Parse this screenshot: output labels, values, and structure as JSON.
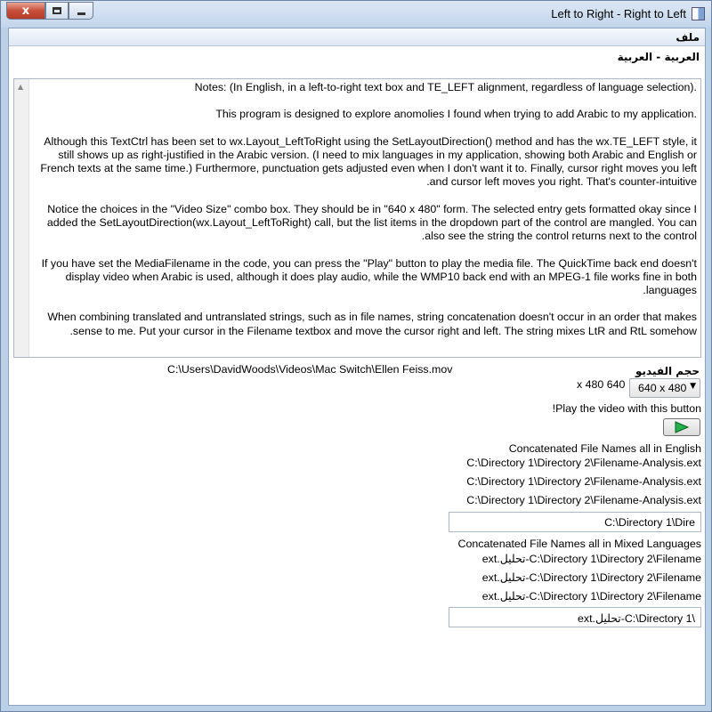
{
  "window": {
    "title": "Left to Right - Right to Left",
    "close_glyph": "x"
  },
  "menu": {
    "file": "ملف"
  },
  "language_title": "العربية - العربية",
  "notes": [
    ".Notes:  (In English, in a left-to-right text box and TE_LEFT alignment, regardless of language selection)",
    ".This program is designed to explore anomolies I found when trying to add Arabic to my application",
    "Although this TextCtrl has been set to wx.Layout_LeftToRight using the SetLayoutDirection() method and has the wx.TE_LEFT style, it still shows up as right-justified in the Arabic version.  (I need to mix languages in my application, showing both Arabic and English or French texts at the same time.)  Furthermore, punctuation gets adjusted even when I don't want it to.  Finally, cursor right moves you left and cursor left moves you right.  That's counter-intuitive.",
    "Notice the choices in the \"Video Size\" combo box.  They should be in \"640 x 480\" form.  The selected entry gets formatted okay since I added the SetLayoutDirection(wx.Layout_LeftToRight) call, but the list items in the dropdown part of the control are mangled.  You can also see the string the control returns next to the control.",
    "If you have set the MediaFilename in the code, you can press the \"Play\" button to play the media file.  The QuickTime back end doesn't display video when Arabic is used, although it does play audio, while the WMP10 back end with an MPEG-1 file works fine in both languages.",
    "When combining translated and untranslated strings, such as in file names, string concatenation doesn't occur in an order that makes sense to me.  Put your cursor in the Filename textbox and move the cursor right and left.  The string mixes LtR and RtL somehow."
  ],
  "video": {
    "size_label": "حجم الفيديو",
    "media_path": "C:\\Users\\DavidWoods\\Videos\\Mac Switch\\Ellen Feiss.mov",
    "size_selected": "640 x 480",
    "size_echo": "x 480 640"
  },
  "play": {
    "label": "!Play the video with this button",
    "icon": "play-icon",
    "icon_color": "#22b14c"
  },
  "english": {
    "title": "Concatenated File Names all in English",
    "lines": [
      "C:\\Directory 1\\Directory 2\\Filename-Analysis.ext",
      "C:\\Directory 1\\Directory 2\\Filename-Analysis.ext",
      "C:\\Directory 1\\Directory 2\\Filename-Analysis.ext"
    ],
    "field_value": "C:\\Directory 1\\Dire"
  },
  "mixed": {
    "title": "Concatenated File Names all in Mixed Languages",
    "lines": [
      "ext.تحليل-C:\\Directory 1\\Directory 2\\Filename",
      "ext.تحليل-C:\\Directory 1\\Directory 2\\Filename",
      "ext.تحليل-C:\\Directory 1\\Directory 2\\Filename"
    ],
    "field_value": "ext.تحليل-C:\\Directory 1\\"
  }
}
